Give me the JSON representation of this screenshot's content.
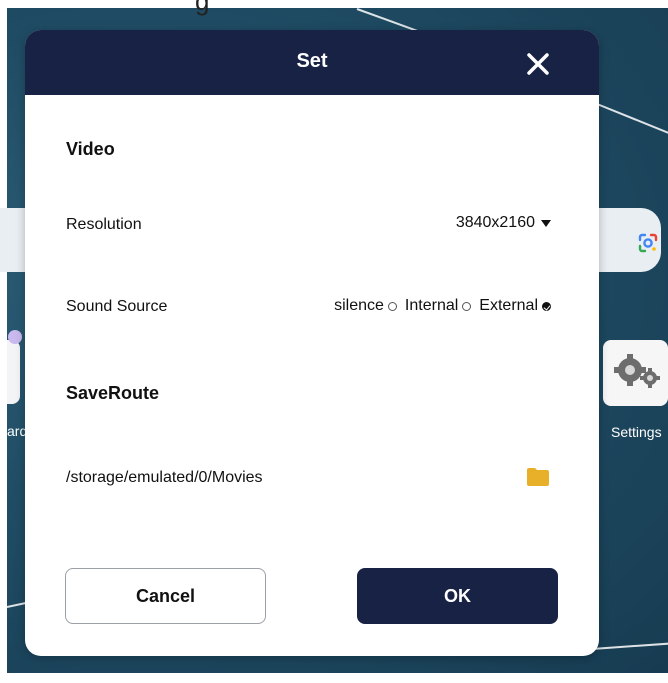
{
  "background": {
    "partial_top_text": "g",
    "left_app_label": "ard",
    "right_app_label": "Settings",
    "icons": [
      "google-lens-icon",
      "settings-gears-icon"
    ]
  },
  "dialog": {
    "title": "Set",
    "close_icon": "close-icon",
    "video_section": "Video",
    "resolution_label": "Resolution",
    "resolution_value": "3840x2160",
    "sound_source_label": "Sound Source",
    "sound_options": [
      {
        "label": "silence",
        "checked": false
      },
      {
        "label": "Internal",
        "checked": false
      },
      {
        "label": "External",
        "checked": true
      }
    ],
    "save_route_section": "SaveRoute",
    "save_path": "/storage/emulated/0/Movies",
    "cancel_label": "Cancel",
    "ok_label": "OK"
  },
  "colors": {
    "header": "#172244",
    "ok_button": "#172244",
    "folder": "#e8b028",
    "background": "#1f4c64"
  }
}
